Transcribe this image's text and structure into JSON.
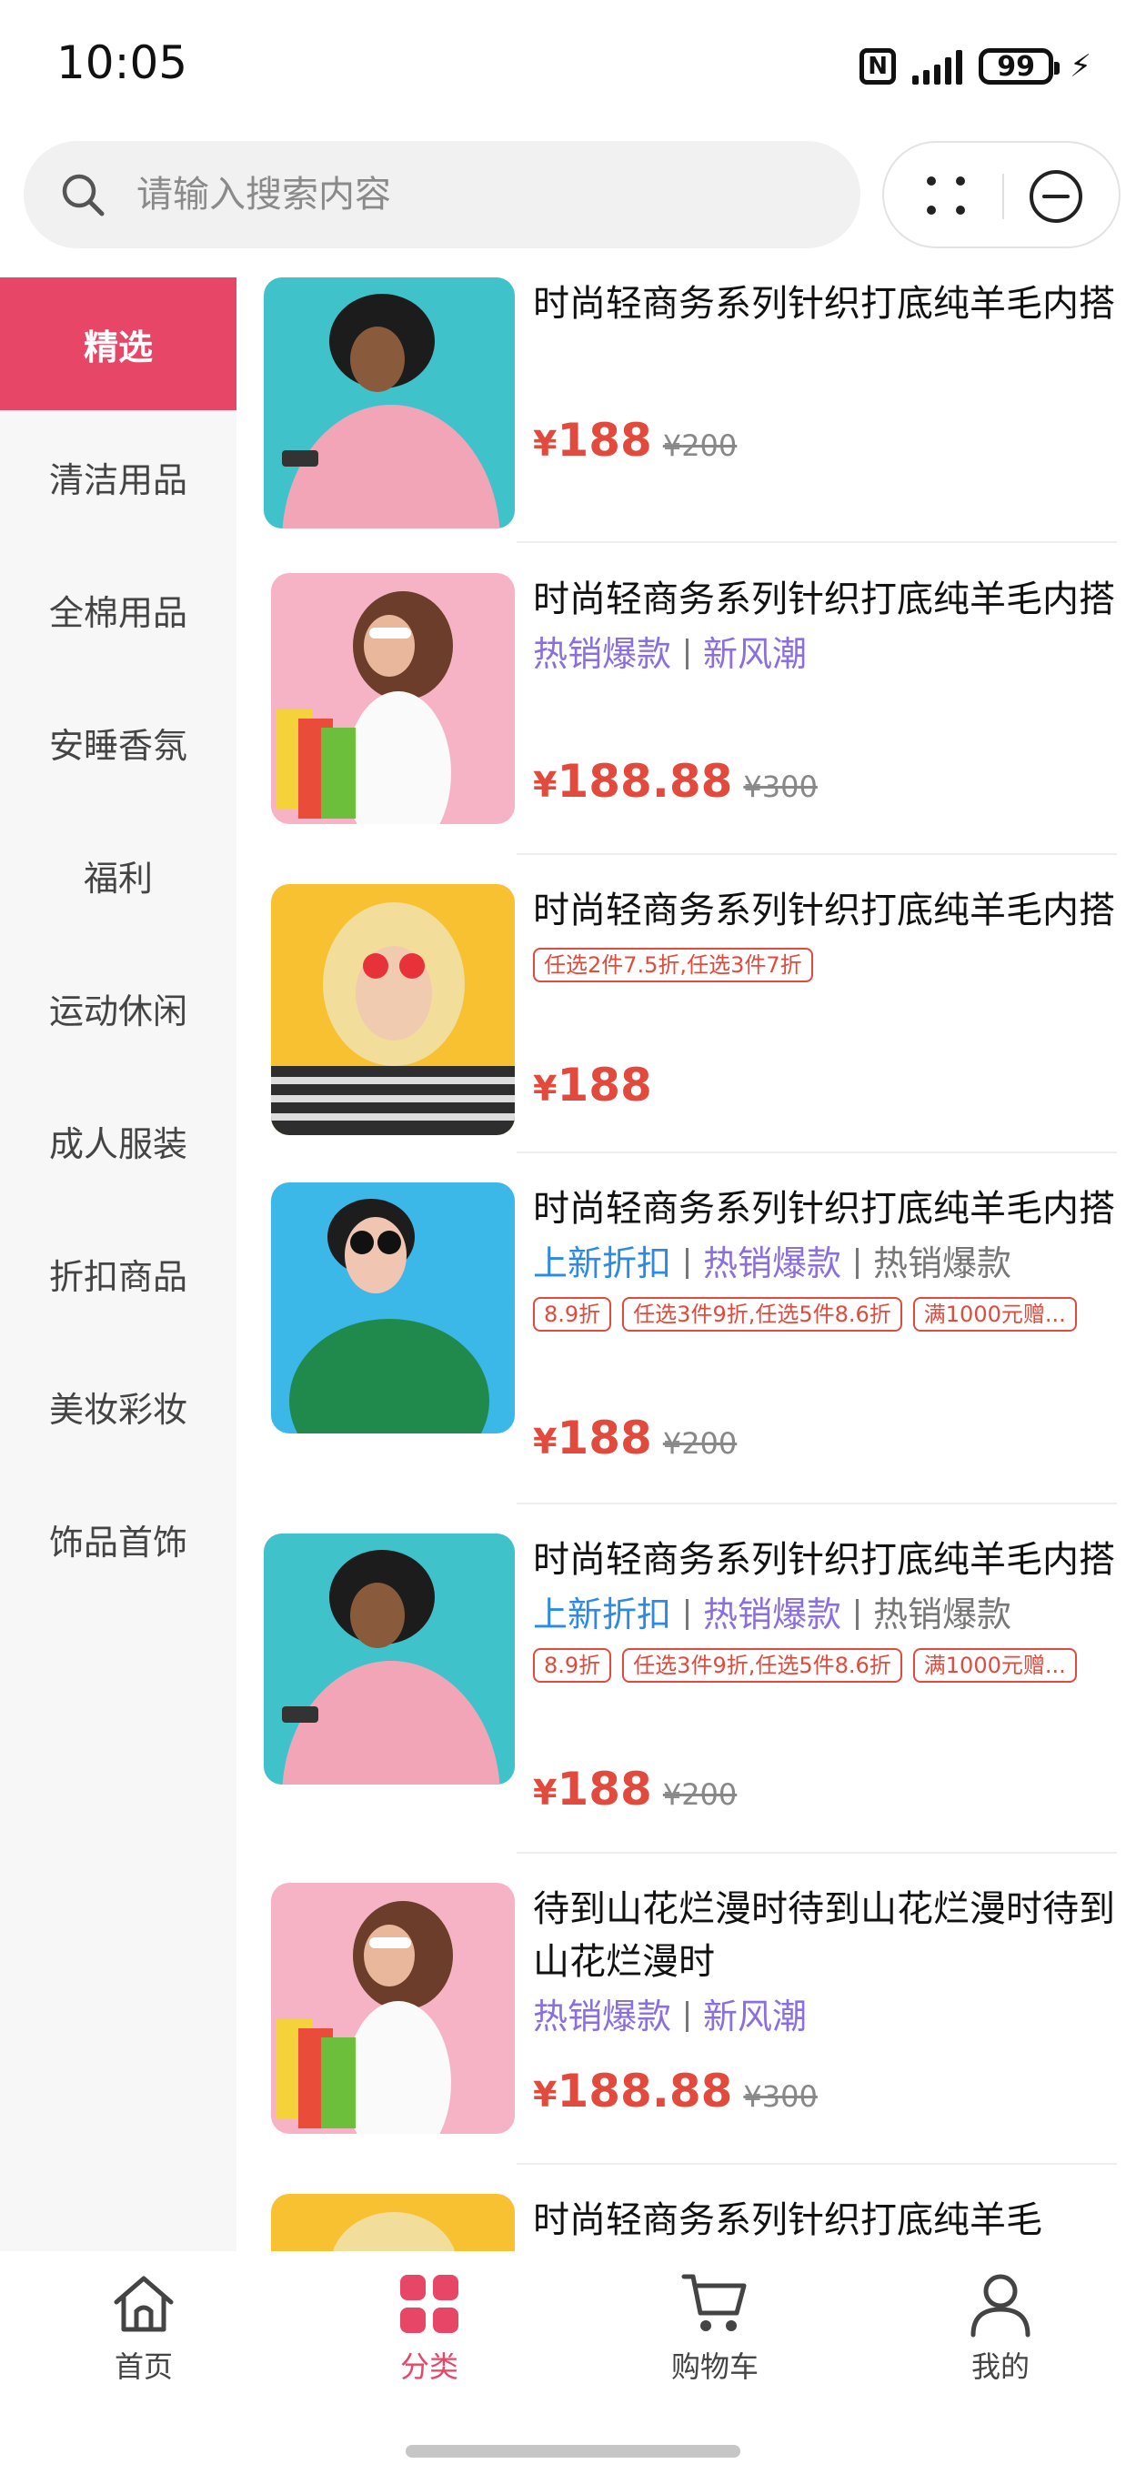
{
  "status": {
    "time": "10:05",
    "battery": "99"
  },
  "search": {
    "placeholder": "请输入搜索内容"
  },
  "sidebar": {
    "items": [
      {
        "label": "精选",
        "active": true
      },
      {
        "label": "清洁用品"
      },
      {
        "label": "全棉用品"
      },
      {
        "label": "安睡香氛"
      },
      {
        "label": "福利"
      },
      {
        "label": "运动休闲"
      },
      {
        "label": "成人服装"
      },
      {
        "label": "折扣商品"
      },
      {
        "label": "美妆彩妆"
      },
      {
        "label": "饰品首饰"
      }
    ]
  },
  "products": [
    {
      "title": "时尚轻商务系列针织打底纯羊毛内搭",
      "price": "188",
      "orig": "¥200",
      "image": "woman-pink-sweater-teal"
    },
    {
      "title": "时尚轻商务系列针织打底纯羊毛内搭",
      "tags": [
        "热销爆款",
        "新风潮"
      ],
      "price": "188.88",
      "orig": "¥300",
      "image": "woman-shopping-bags-pink"
    },
    {
      "title": "时尚轻商务系列针织打底纯羊毛内搭",
      "promos": [
        "任选2件7.5折,任选3件7折"
      ],
      "price": "188",
      "image": "woman-heart-glasses-yellow"
    },
    {
      "title": "时尚轻商务系列针织打底纯羊毛内搭",
      "tags": [
        "上新折扣",
        "热销爆款",
        "热销爆款"
      ],
      "promos": [
        "8.9折",
        "任选3件9折,任选5件8.6折",
        "满1000元赠..."
      ],
      "price": "188",
      "orig": "¥200",
      "image": "woman-green-shirt-blue"
    },
    {
      "title": "时尚轻商务系列针织打底纯羊毛内搭",
      "tags": [
        "上新折扣",
        "热销爆款",
        "热销爆款"
      ],
      "promos": [
        "8.9折",
        "任选3件9折,任选5件8.6折",
        "满1000元赠..."
      ],
      "price": "188",
      "orig": "¥200",
      "image": "woman-pink-sweater-teal"
    },
    {
      "title": "待到山花烂漫时待到山花烂漫时待到山花烂漫时",
      "tags": [
        "热销爆款",
        "新风潮"
      ],
      "price": "188.88",
      "orig": "¥300",
      "image": "woman-shopping-bags-pink"
    },
    {
      "title": "时尚轻商务系列针织打底纯羊毛",
      "image": "woman-yellow"
    }
  ],
  "currency": "¥",
  "tabbar": {
    "items": [
      {
        "label": "首页",
        "icon": "home-icon"
      },
      {
        "label": "分类",
        "icon": "category-grid-icon",
        "active": true
      },
      {
        "label": "购物车",
        "icon": "cart-icon"
      },
      {
        "label": "我的",
        "icon": "user-icon"
      }
    ]
  },
  "colors": {
    "accent": "#e84667",
    "price": "#e14a3c",
    "tagBlue": "#2a8ae6",
    "tagPurple": "#8b6fe0"
  }
}
